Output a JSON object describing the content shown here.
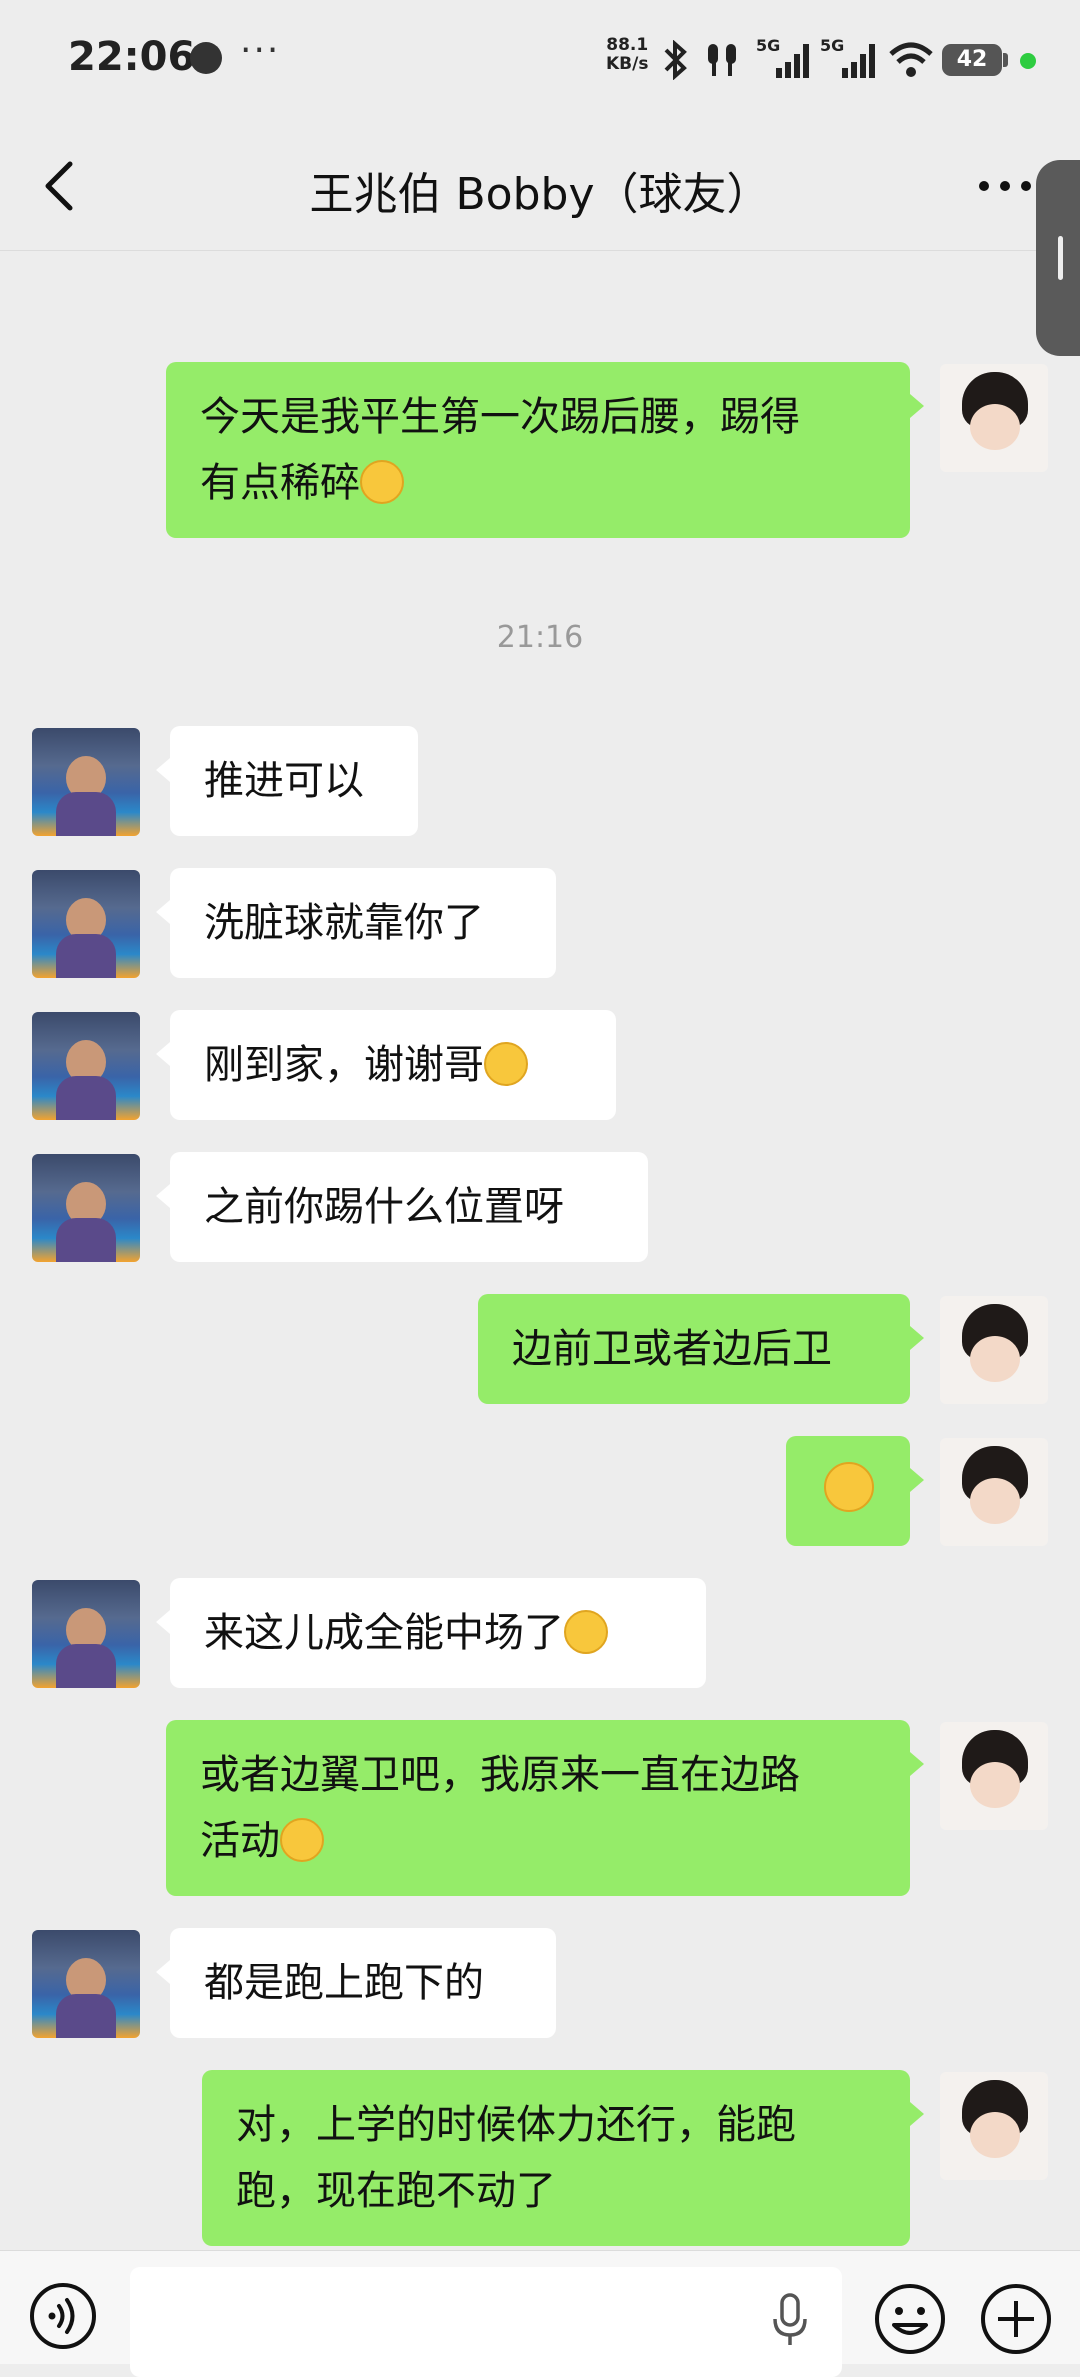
{
  "status_bar": {
    "time": "22:06",
    "more_dots": "···",
    "net_speed_value": "88.1",
    "net_speed_unit": "KB/s",
    "signal_1_label": "5G",
    "signal_2_label": "5G",
    "battery": "42"
  },
  "header": {
    "title": "王兆伯 Bobby（球友）"
  },
  "messages": [
    {
      "sender": "self",
      "text": "今天是我平生第一次踢后腰，踢得\n有点稀碎",
      "emoji": "face-with-tears-of-joy"
    },
    {
      "timestamp": "21:16"
    },
    {
      "sender": "friend",
      "text": "推进可以"
    },
    {
      "sender": "friend",
      "text": "洗脏球就靠你了"
    },
    {
      "sender": "friend",
      "text": "刚到家，谢谢哥",
      "emoji": "grinning-face"
    },
    {
      "sender": "friend",
      "text": "之前你踢什么位置呀"
    },
    {
      "sender": "self",
      "text": "边前卫或者边后卫"
    },
    {
      "sender": "self",
      "text": "",
      "emoji": "face-with-tears-of-joy"
    },
    {
      "sender": "friend",
      "text": "来这儿成全能中场了",
      "emoji": "rolling-on-the-floor-laughing"
    },
    {
      "sender": "self",
      "text": "或者边翼卫吧，我原来一直在边路\n活动",
      "emoji": "face-with-tears-of-joy"
    },
    {
      "sender": "friend",
      "text": "都是跑上跑下的"
    },
    {
      "sender": "self",
      "text": "对，上学的时候体力还行，能跑\n跑，现在跑不动了"
    }
  ],
  "input_bar": {
    "placeholder": ""
  },
  "colors": {
    "background": "#ededed",
    "self_bubble": "#95ec69",
    "friend_bubble": "#ffffff",
    "timestamp_text": "#999999"
  }
}
